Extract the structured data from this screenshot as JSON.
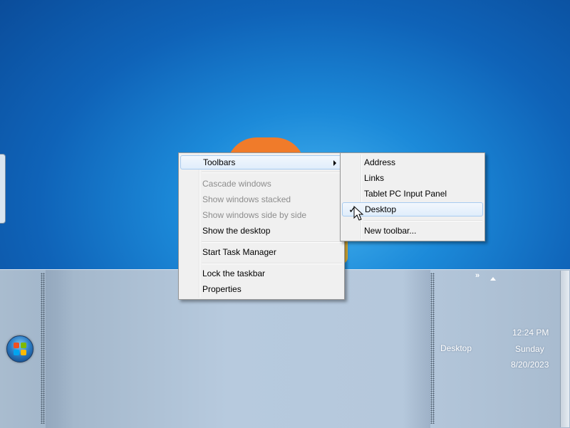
{
  "taskbar": {
    "toolbar_label": "Desktop",
    "chevron": "»",
    "clock": {
      "time": "12:24 PM",
      "day": "Sunday",
      "date": "8/20/2023"
    }
  },
  "context_menu": {
    "items": [
      {
        "label": "Toolbars",
        "state": "highlighted",
        "submenu": true
      },
      {
        "label": "Cascade windows",
        "state": "disabled"
      },
      {
        "label": "Show windows stacked",
        "state": "disabled"
      },
      {
        "label": "Show windows side by side",
        "state": "disabled"
      },
      {
        "label": "Show the desktop",
        "state": "enabled"
      },
      {
        "label": "Start Task Manager",
        "state": "enabled"
      },
      {
        "label": "Lock the taskbar",
        "state": "enabled"
      },
      {
        "label": "Properties",
        "state": "enabled"
      }
    ]
  },
  "toolbars_submenu": {
    "items": [
      {
        "label": "Address",
        "checked": false
      },
      {
        "label": "Links",
        "checked": false
      },
      {
        "label": "Tablet PC Input Panel",
        "checked": false
      },
      {
        "label": "Desktop",
        "checked": true,
        "state": "highlighted"
      },
      {
        "label": "New toolbar...",
        "checked": false
      }
    ],
    "check_glyph": "✓"
  },
  "colors": {
    "desktop_blue": "#1c8ad9",
    "taskbar": "#b5c8dc",
    "menu_bg": "#f0f0f0",
    "highlight_border": "#a8cbf0"
  }
}
